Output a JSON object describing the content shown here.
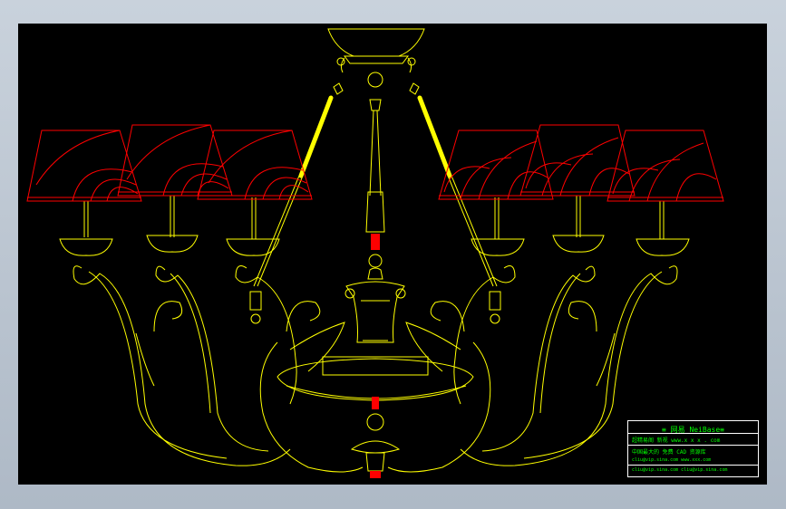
{
  "colors": {
    "background": "#000000",
    "frame": "#b7c2ce",
    "lamp_body": "#ffff00",
    "shade": "#ff0000",
    "stamp_text": "#00ff00",
    "stamp_border": "#ffffff"
  },
  "drawing": {
    "shade_count": 6,
    "arm_count": 6
  },
  "stamp": {
    "title": "≡ 网易 NeiBase≡",
    "line2": "超精易阁 新视      www.x x x . com",
    "line3": "中国最大的 免费 CAD 资源库",
    "line4": "cliu@vip.sina.com    www.xxx.com",
    "line5": "cliu@vip.sina.com    cliu@vip.sina.com"
  }
}
